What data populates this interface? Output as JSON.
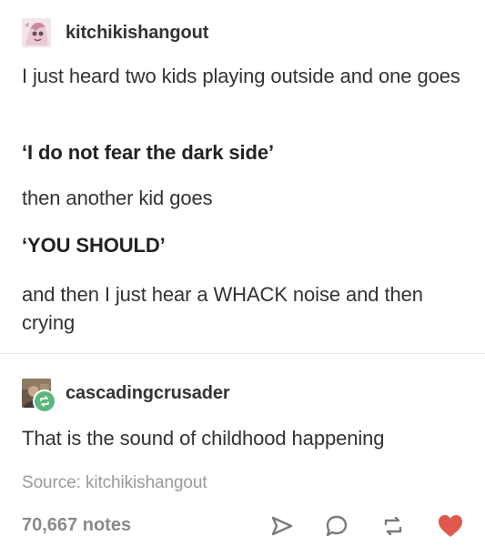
{
  "post": {
    "original": {
      "username": "kitchikishangout",
      "avatar_icon": "anime-character-avatar",
      "lines": [
        "I just heard two kids playing outside and one goes",
        "‘I do not fear the dark side’",
        "then another kid goes",
        "‘YOU SHOULD’",
        "and then I just hear a WHACK noise and then crying"
      ]
    },
    "reblog": {
      "username": "cascadingcrusader",
      "avatar_icon": "profile-photo-avatar",
      "badge_icon": "reblog-icon",
      "text": "That is the sound of childhood happening"
    },
    "source": "Source: kitchikishangout",
    "footer": {
      "notes": "70,667 notes",
      "icons": [
        "share-icon",
        "reply-icon",
        "reblog-icon",
        "like-icon"
      ],
      "like_color": "#e0584b"
    }
  }
}
